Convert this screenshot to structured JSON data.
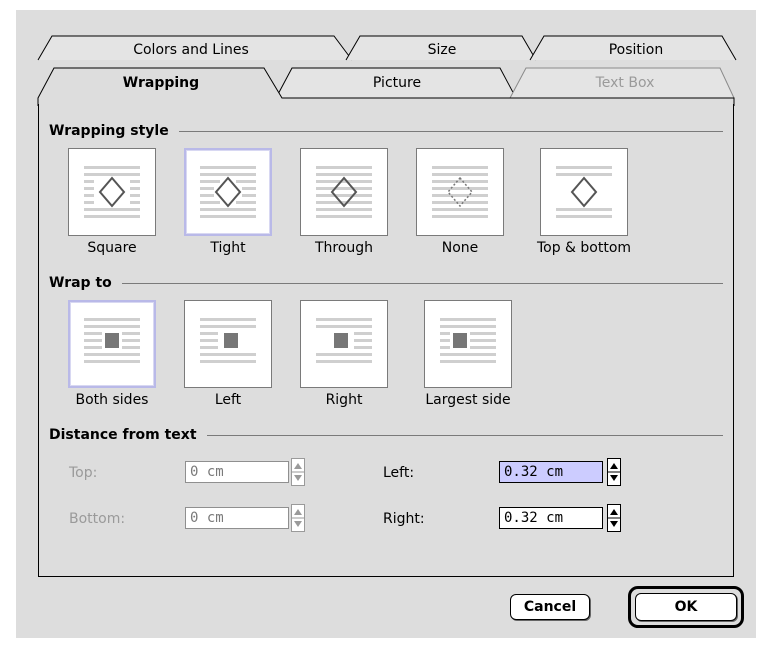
{
  "tabs": {
    "back_row": [
      "Colors and Lines",
      "Size",
      "Position"
    ],
    "front_row": [
      "Wrapping",
      "Picture",
      "Text Box"
    ],
    "active": "Wrapping",
    "disabled": [
      "Text Box"
    ]
  },
  "wrapping_style": {
    "heading": "Wrapping style",
    "options": [
      "Square",
      "Tight",
      "Through",
      "None",
      "Top & bottom"
    ],
    "selected": "Tight"
  },
  "wrap_to": {
    "heading": "Wrap to",
    "options": [
      "Both sides",
      "Left",
      "Right",
      "Largest side"
    ],
    "selected": "Both sides"
  },
  "distance": {
    "heading": "Distance from text",
    "top_label": "Top:",
    "top_value": "0 cm",
    "bottom_label": "Bottom:",
    "bottom_value": "0 cm",
    "left_label": "Left:",
    "left_value": "0.32 cm",
    "right_label": "Right:",
    "right_value": "0.32 cm"
  },
  "buttons": {
    "cancel": "Cancel",
    "ok": "OK"
  },
  "colors": {
    "dialog_bg": "#dddddd",
    "selection": "#b9b9e8",
    "field_highlight": "#ccccff",
    "disabled_text": "#9a9a9a"
  }
}
